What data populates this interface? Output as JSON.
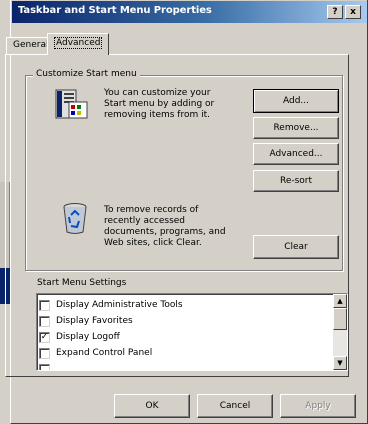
{
  "window": {
    "title": "Taskbar and Start Menu Properties",
    "help_label": "?",
    "close_label": "x"
  },
  "tabs": [
    {
      "label": "General",
      "selected": false
    },
    {
      "label": "Advanced",
      "selected": true
    }
  ],
  "customize_group": {
    "label": "Customize Start menu",
    "description": [
      "You can customize your",
      "Start menu by adding or",
      "removing items from it."
    ],
    "buttons": {
      "add": "Add...",
      "remove": "Remove...",
      "advanced": "Advanced...",
      "resort": "Re-sort"
    },
    "remove_records": [
      "To remove records of",
      "recently accessed",
      "documents, programs, and",
      "Web sites,  click Clear."
    ],
    "clear_label": "Clear"
  },
  "settings": {
    "label": "Start Menu Settings",
    "items": [
      {
        "label": "Display Administrative Tools",
        "checked": false
      },
      {
        "label": "Display Favorites",
        "checked": false
      },
      {
        "label": "Display Logoff",
        "checked": true
      },
      {
        "label": "Expand Control Panel",
        "checked": false
      },
      {
        "label": "",
        "checked": false
      }
    ]
  },
  "footer": {
    "ok": "OK",
    "cancel": "Cancel",
    "apply": "Apply"
  },
  "colors": {
    "title_start": "#0a246a",
    "title_end": "#a6caf0",
    "face": "#d4d0c8"
  },
  "icons": {
    "start_menu": "start-menu-icon",
    "recycle": "recycle-bin-icon",
    "check": "checkmark-icon"
  }
}
